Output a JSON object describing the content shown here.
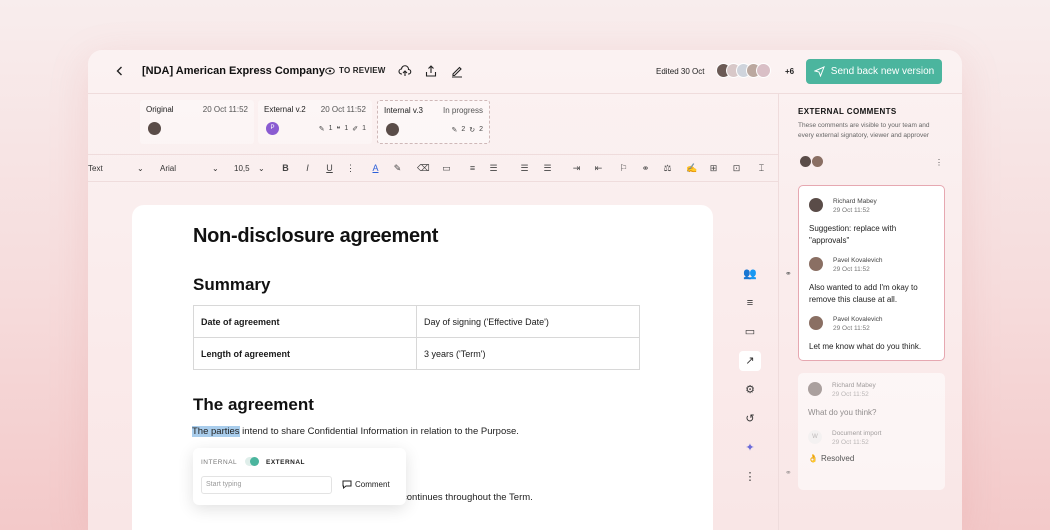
{
  "header": {
    "back_icon": "chevron-left-icon",
    "title": "[NDA] American Express Company",
    "review_status": "TO REVIEW",
    "edited": "Edited 30 Oct",
    "extra_collaborators": "+6",
    "send_button": "Send back new version",
    "accent_color": "#4bb59e"
  },
  "versions": [
    {
      "name": "Original",
      "date": "20 Oct 11:52"
    },
    {
      "name": "External v.2",
      "date": "20 Oct 11:52",
      "avatar_letter": "P",
      "stats": [
        "1",
        "1",
        "1"
      ]
    },
    {
      "name": "Internal v.3",
      "date": "In progress",
      "stats": [
        "2",
        "2"
      ]
    }
  ],
  "toolbar": {
    "style": "Text",
    "font": "Arial",
    "size": "10,5"
  },
  "doc": {
    "title": "Non-disclosure agreement",
    "summary_heading": "Summary",
    "table": [
      [
        "Date of agreement",
        "Day of signing ('Effective Date')"
      ],
      [
        "Length of agreement",
        "3 years ('Term')"
      ]
    ],
    "agreement_heading": "The agreement",
    "paragraph_highlight": "The parties",
    "paragraph_rest": " intend to share Confidential Information in relation to the Purpose.",
    "paragraph_tail": "continues throughout the Term."
  },
  "popup": {
    "internal": "INTERNAL",
    "external": "EXTERNAL",
    "placeholder": "Start typing",
    "comment_button": "Comment"
  },
  "panel": {
    "title": "EXTERNAL COMMENTS",
    "description": "These comments are visible to your team and every external signatory, viewer and approver",
    "thread1": [
      {
        "author": "Richard Mabey",
        "date": "29 Oct 11:52",
        "text": "Suggestion: replace with \"approvals\""
      },
      {
        "author": "Pavel Kovalevich",
        "date": "29 Oct 11:52",
        "text": "Also wanted to add I'm okay to remove this clause at all."
      },
      {
        "author": "Pavel Kovalevich",
        "date": "29 Oct 11:52",
        "text": "Let me know what do you think."
      }
    ],
    "thread2": [
      {
        "author": "Richard Mabey",
        "date": "29 Oct 11:52",
        "text": "What do you think?"
      },
      {
        "author": "Document import",
        "date": "29 Oct 11:52",
        "avatar_letter": "W"
      }
    ],
    "resolved": "Resolved"
  }
}
